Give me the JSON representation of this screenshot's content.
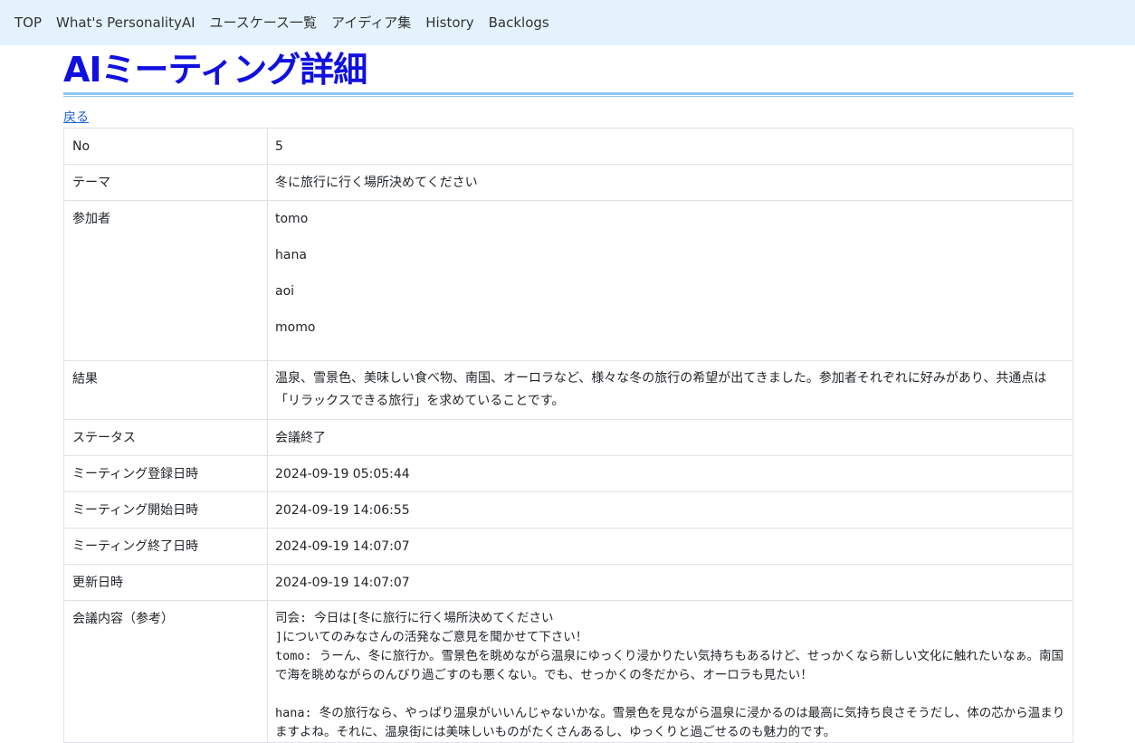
{
  "nav": {
    "items": [
      "TOP",
      "What's PersonalityAI",
      "ユースケース一覧",
      "アイディア集",
      "History",
      "Backlogs"
    ]
  },
  "page": {
    "title": "AIミーティング詳細",
    "back_label": "戻る"
  },
  "detail": {
    "no_label": "No",
    "no_value": "5",
    "theme_label": "テーマ",
    "theme_value": "冬に旅行に行く場所決めてください",
    "participants_label": "参加者",
    "participants": [
      "tomo",
      "hana",
      "aoi",
      "momo"
    ],
    "result_label": "結果",
    "result_value": "温泉、雪景色、美味しい食べ物、南国、オーロラなど、様々な冬の旅行の希望が出てきました。参加者それぞれに好みがあり、共通点は「リラックスできる旅行」を求めていることです。",
    "status_label": "ステータス",
    "status_value": "会議終了",
    "registered_label": "ミーティング登録日時",
    "registered_value": "2024-09-19 05:05:44",
    "started_label": "ミーティング開始日時",
    "started_value": "2024-09-19 14:06:55",
    "ended_label": "ミーティング終了日時",
    "ended_value": "2024-09-19 14:07:07",
    "updated_label": "更新日時",
    "updated_value": "2024-09-19 14:07:07",
    "log_label": "会議内容（参考）",
    "log_value": "司会: 今日は[冬に旅行に行く場所決めてください\n]についてのみなさんの活発なご意見を聞かせて下さい！\ntomo: うーん、冬に旅行か。雪景色を眺めながら温泉にゆっくり浸かりたい気持ちもあるけど、せっかくなら新しい文化に触れたいなぁ。南国で海を眺めながらのんびり過ごすのも悪くない。でも、せっかくの冬だから、オーロラも見たい！\n\nhana: 冬の旅行なら、やっぱり温泉がいいんじゃないかな。雪景色を見ながら温泉に浸かるのは最高に気持ち良さそうだし、体の芯から温まりますよね。それに、温泉街には美味しいものがたくさんあるし、ゆっくりと過ごせるのも魅力的です。"
  }
}
